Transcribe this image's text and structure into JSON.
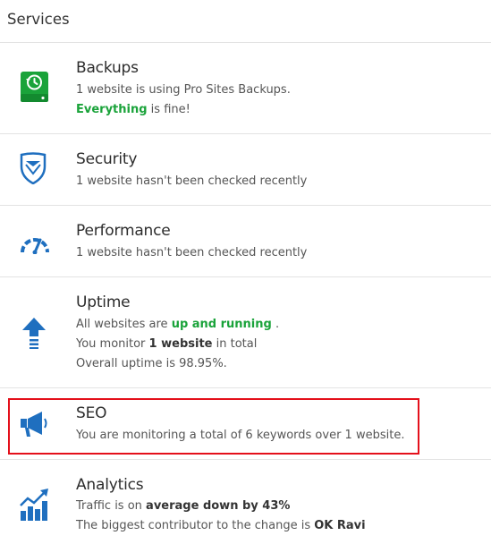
{
  "header": {
    "title": "Services"
  },
  "services": {
    "backups": {
      "title": "Backups",
      "line1": "1 website is using Pro Sites Backups.",
      "line2_highlight": "Everything",
      "line2_rest": " is fine!"
    },
    "security": {
      "title": "Security",
      "line1": "1 website hasn't been checked recently"
    },
    "performance": {
      "title": "Performance",
      "line1": "1 website hasn't been checked recently"
    },
    "uptime": {
      "title": "Uptime",
      "line1_pre": "All websites are ",
      "line1_highlight": "up and running",
      "line1_post": " .",
      "line2_pre": "You monitor ",
      "line2_bold": "1 website",
      "line2_post": " in total",
      "line3": "Overall uptime is 98.95%."
    },
    "seo": {
      "title": "SEO",
      "line1": "You are monitoring a total of 6 keywords over 1 website."
    },
    "analytics": {
      "title": "Analytics",
      "line1_pre": "Traffic is on ",
      "line1_bold": "average down by 43%",
      "line2_pre": "The biggest contributor to the change is ",
      "line2_bold": "OK Ravi"
    }
  },
  "icons": {
    "backups": "backup-drive-icon",
    "security": "shield-icon",
    "performance": "speedometer-icon",
    "uptime": "up-arrow-icon",
    "seo": "megaphone-icon",
    "analytics": "growth-chart-icon"
  },
  "colors": {
    "green": "#1aa33a",
    "blue": "#1f6fbf",
    "highlight_border": "#e4101b"
  }
}
